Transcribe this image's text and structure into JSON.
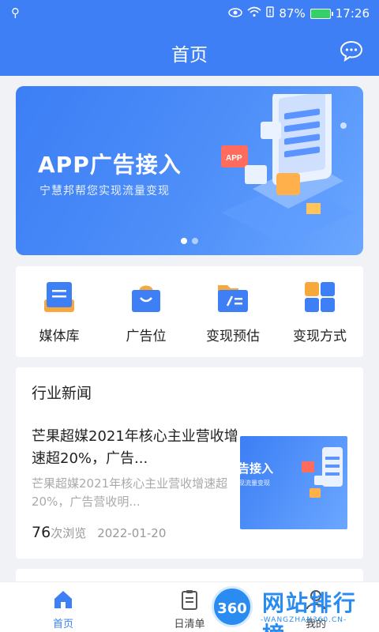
{
  "status_bar": {
    "battery": "87%",
    "time": "17:26"
  },
  "header": {
    "title": "首页"
  },
  "banner": {
    "title": "APP广告接入",
    "subtitle": "宁慧邦帮您实现流量变现",
    "page_count": 2,
    "active_page": 1
  },
  "menu": [
    {
      "label": "媒体库",
      "icon": "media-library-icon"
    },
    {
      "label": "广告位",
      "icon": "ad-slot-icon"
    },
    {
      "label": "变现预估",
      "icon": "monetization-estimate-icon"
    },
    {
      "label": "变现方式",
      "icon": "monetization-methods-icon"
    }
  ],
  "news": {
    "section_title": "行业新闻",
    "items": [
      {
        "title": "芒果超媒2021年核心主业营收增速超20%，广告...",
        "desc": "芒果超媒2021年核心主业营收增速超20%，广告营收明...",
        "views": "76",
        "views_suffix": "次浏览",
        "date": "2022-01-20",
        "thumb_title": "广告接入",
        "thumb_sub": "实现流量变现"
      }
    ]
  },
  "tabbar": [
    {
      "label": "首页",
      "icon": "home-icon",
      "active": true
    },
    {
      "label": "日清单",
      "icon": "daily-list-icon",
      "active": false
    },
    {
      "label": "我的",
      "icon": "profile-icon",
      "active": false
    }
  ],
  "watermark": {
    "badge": "360",
    "name": "网站排行榜",
    "url": "-WANGZHAN360.CN-"
  },
  "colors": {
    "primary": "#3e7ff6",
    "orange": "#f7a83c",
    "text": "#222222",
    "muted": "#aaaaaa"
  }
}
